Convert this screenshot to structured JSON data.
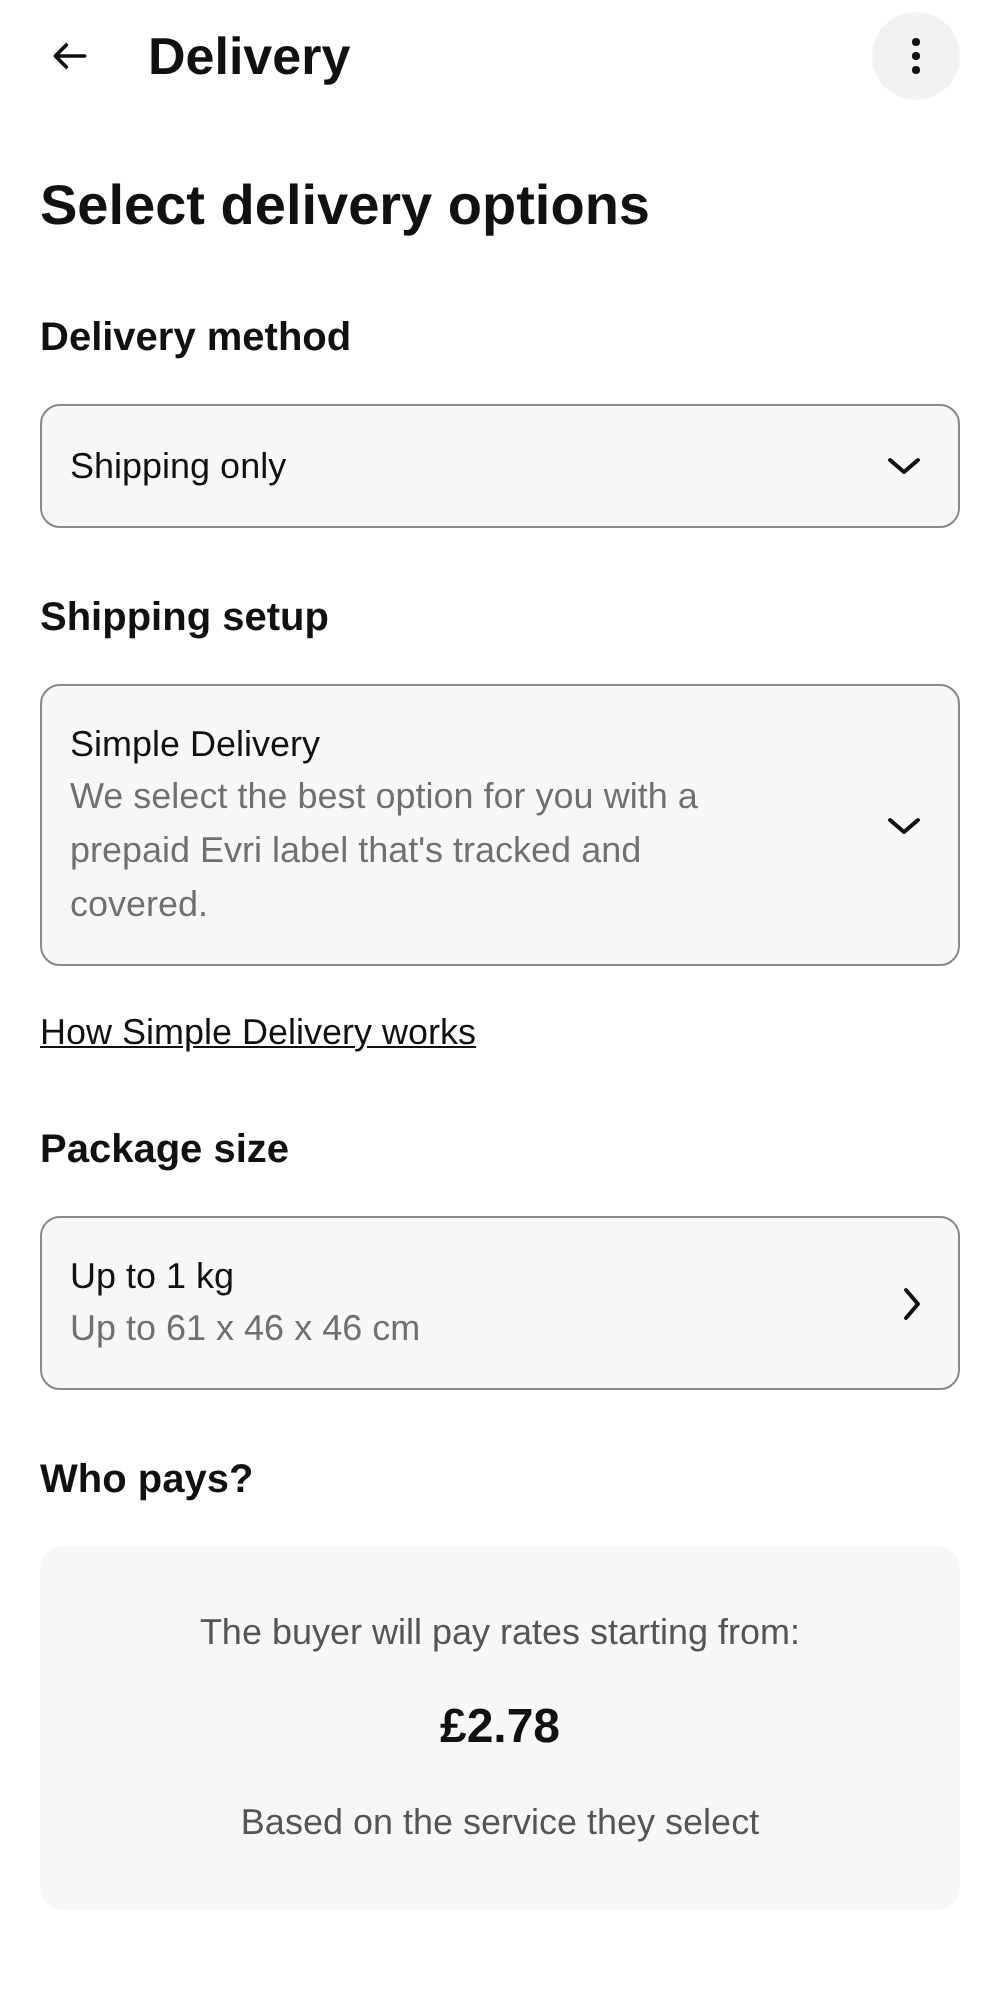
{
  "header": {
    "title": "Delivery"
  },
  "page_title": "Select delivery options",
  "sections": [
    {
      "heading": "Delivery method",
      "field": {
        "kind": "dropdown",
        "value": "Shipping only"
      }
    },
    {
      "heading": "Shipping setup",
      "field": {
        "kind": "dropdown",
        "value": "Simple Delivery",
        "description": "We select the best option for you with a prepaid Evri label that's tracked and covered."
      },
      "link": "How Simple Delivery works"
    },
    {
      "heading": "Package size",
      "field": {
        "kind": "navigate",
        "value": "Up to 1 kg",
        "description": "Up to 61 x 46 x 46 cm"
      }
    },
    {
      "heading": "Who pays?",
      "info": {
        "intro": "The buyer will pay rates starting from:",
        "price": "£2.78",
        "note": "Based on the service they select"
      }
    }
  ]
}
